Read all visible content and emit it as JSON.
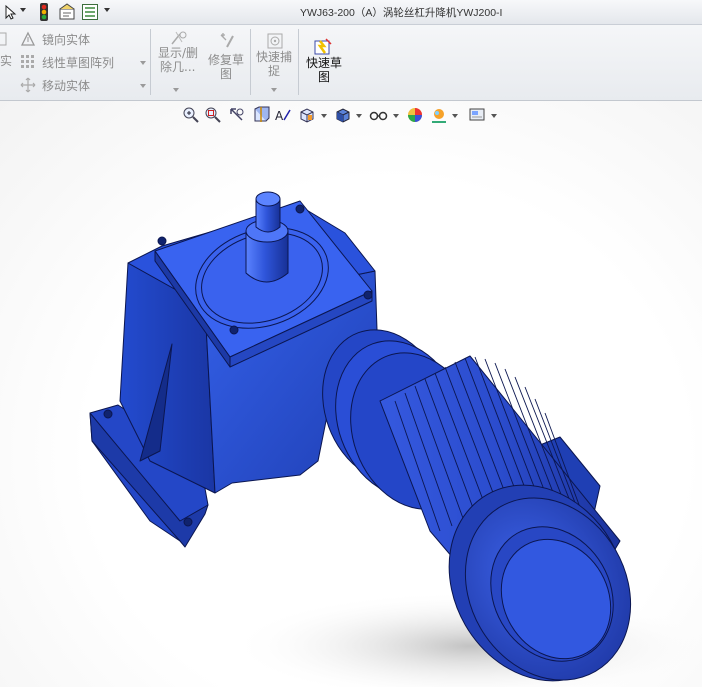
{
  "window": {
    "title": "YWJ63-200（A）涡轮丝杠升降机YWJ200-I"
  },
  "quick_access": {
    "icons": [
      "select-pointer-icon",
      "traffic-light-icon",
      "options-icon",
      "properties-icon"
    ]
  },
  "ribbon": {
    "partial_left_label": "实",
    "group1": {
      "items": [
        {
          "label": "镜向实体",
          "icon": "mirror-icon"
        },
        {
          "label": "线性草图阵列",
          "icon": "linear-pattern-icon"
        },
        {
          "label": "移动实体",
          "icon": "move-entities-icon"
        }
      ]
    },
    "show_delete": {
      "line1": "显示/删",
      "line2": "除几..."
    },
    "repair_sketch": {
      "line1": "修复草",
      "line2": "图"
    },
    "quick_snaps": {
      "line1": "快速捕",
      "line2": "捉"
    },
    "rapid_sketch": {
      "line1": "快速草",
      "line2": "图"
    }
  },
  "heads_up_toolbar": {
    "icons": [
      "zoom-to-fit-icon",
      "zoom-to-area-icon",
      "previous-view-icon",
      "section-view-icon",
      "dynamic-annotation-icon",
      "view-orientation-icon",
      "display-style-icon",
      "hide-show-items-icon",
      "edit-appearance-icon",
      "apply-scene-icon",
      "view-settings-icon"
    ]
  },
  "colors": {
    "model_blue": "#2a4fd0",
    "model_dark": "#13257a",
    "model_light": "#5f86ff",
    "accent_yellow": "#f2c200"
  }
}
